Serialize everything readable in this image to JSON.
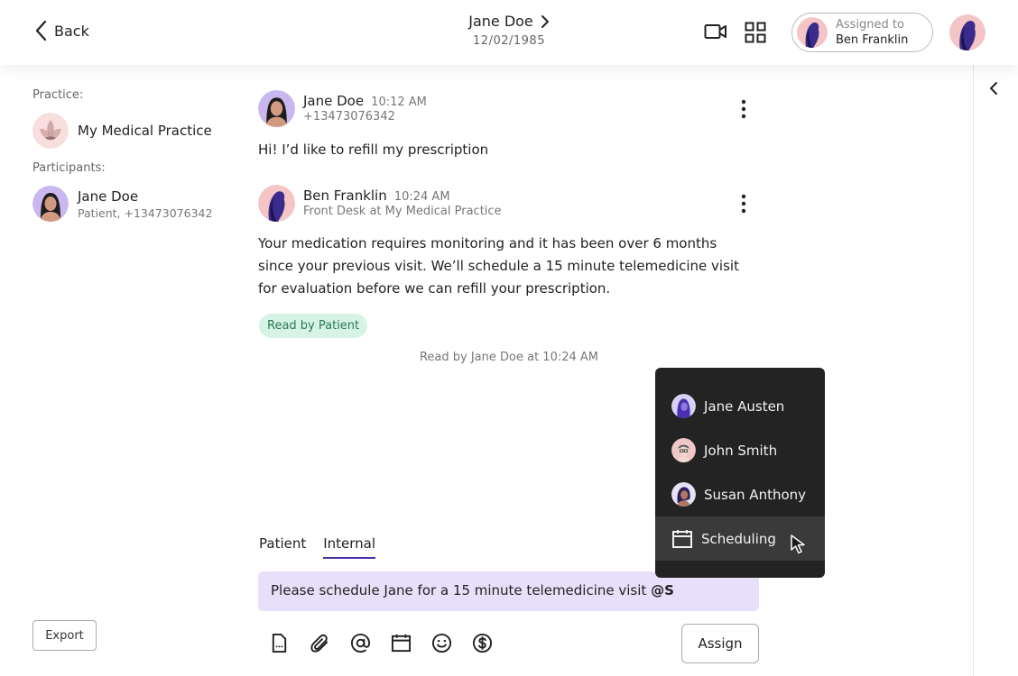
{
  "header": {
    "back_label": "Back",
    "patient_name": "Jane Doe",
    "patient_dob": "12/02/1985",
    "assigned_label": "Assigned to",
    "assigned_name": "Ben Franklin"
  },
  "sidebar": {
    "practice_label": "Practice:",
    "practice_name": "My Medical Practice",
    "participants_label": "Participants:",
    "participants": [
      {
        "name": "Jane Doe",
        "meta": "Patient, +13473076342"
      }
    ],
    "export_label": "Export"
  },
  "messages": [
    {
      "author": "Jane Doe",
      "time": "10:12 AM",
      "sub": "+13473076342",
      "body": "Hi! I’d like to refill my prescription"
    },
    {
      "author": "Ben Franklin",
      "time": "10:24 AM",
      "sub": "Front Desk at My Medical Practice",
      "body_lines": [
        "Your medication requires monitoring and it has been over 6 months",
        "since your previous visit. We’ll schedule a 15 minute telemedicine visit",
        "for evaluation before we can refill your prescription."
      ],
      "badge": "Read by Patient"
    }
  ],
  "read_receipt": "Read by Jane Doe at 10:24 AM",
  "tabs": [
    {
      "label": "Patient",
      "active": false
    },
    {
      "label": "Internal",
      "active": true
    }
  ],
  "compose": {
    "text": "Please schedule Jane for a 15 minute telemedicine visit ",
    "mention": "@S"
  },
  "assign_label": "Assign",
  "mention_menu": {
    "items": [
      {
        "label": "Jane Austen",
        "icon": "jane-austen-avatar"
      },
      {
        "label": "John Smith",
        "icon": "john-smith-avatar"
      },
      {
        "label": "Susan Anthony",
        "icon": "susan-anthony-avatar"
      },
      {
        "label": "Scheduling",
        "icon": "calendar-icon",
        "highlighted": true
      }
    ]
  },
  "colors": {
    "accent": "#4b2fa8",
    "compose_bg": "#e8e0fb",
    "badge_bg": "#d6f3e6",
    "badge_text": "#2c7a55",
    "menu_bg": "#232323"
  }
}
